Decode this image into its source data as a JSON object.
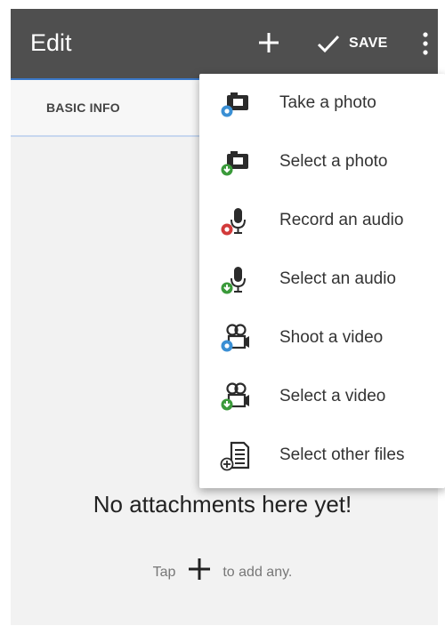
{
  "appbar": {
    "title": "Edit",
    "save_label": "SAVE",
    "background_color": "#4f4f4f",
    "icons": [
      "plus-icon",
      "check-icon",
      "more-vert-icon"
    ]
  },
  "tabs": [
    {
      "label": "BASIC INFO"
    }
  ],
  "menu": {
    "items": [
      {
        "label": "Take a photo",
        "icon": "camera-capture-icon",
        "badge_color": "#3a8fd4"
      },
      {
        "label": "Select a photo",
        "icon": "camera-select-icon",
        "badge_color": "#3a9a3a"
      },
      {
        "label": "Record an audio",
        "icon": "mic-record-icon",
        "badge_color": "#d23a3a"
      },
      {
        "label": "Select an audio",
        "icon": "mic-select-icon",
        "badge_color": "#3a9a3a"
      },
      {
        "label": "Shoot a video",
        "icon": "video-shoot-icon",
        "badge_color": "#3a8fd4"
      },
      {
        "label": "Select a video",
        "icon": "video-select-icon",
        "badge_color": "#3a9a3a"
      },
      {
        "label": "Select other files",
        "icon": "file-add-icon",
        "badge_color": "#333333"
      }
    ]
  },
  "empty_state": {
    "title": "No attachments here yet!",
    "hint_prefix": "Tap",
    "hint_suffix": "to add any."
  }
}
